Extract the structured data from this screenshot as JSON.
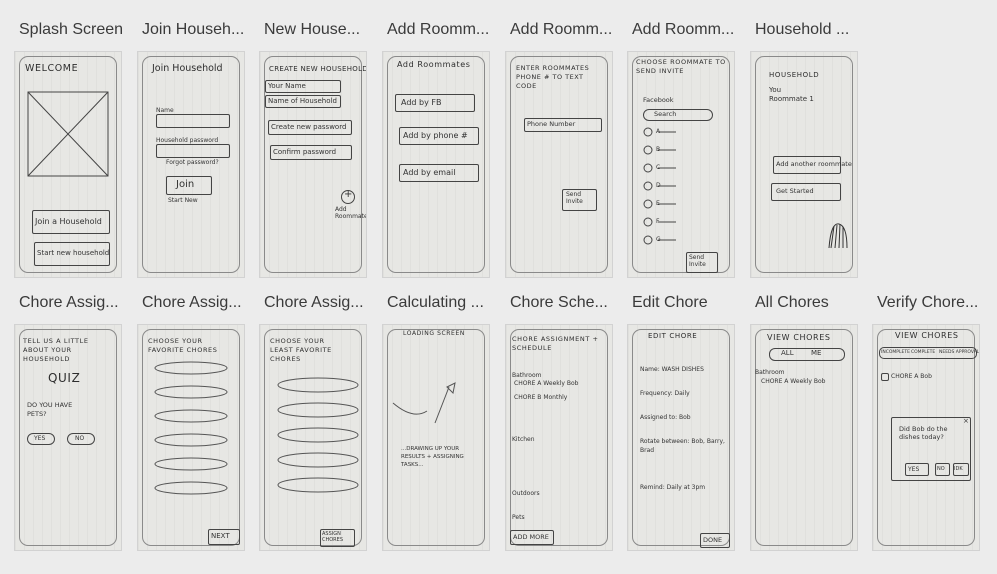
{
  "screens": [
    {
      "title": "Splash Screen",
      "header": "WELCOME",
      "buttons": [
        "Join a Household",
        "Start new household"
      ]
    },
    {
      "title": "Join Househ...",
      "header": "Join Household",
      "fields": [
        "Name",
        "Household password"
      ],
      "link": "Forgot password?",
      "button": "Join",
      "footer": "Start New"
    },
    {
      "title": "New House...",
      "header": "CREATE NEW HOUSEHOLD",
      "fields": [
        "Your Name",
        "Name of Household",
        "Create new password",
        "Confirm password"
      ],
      "add": "Add Roommate"
    },
    {
      "title": "Add Roomm...",
      "header": "Add Roommates",
      "buttons": [
        "Add by FB",
        "Add by phone #",
        "Add by email"
      ]
    },
    {
      "title": "Add Roomm...",
      "header": "ENTER ROOMMATES PHONE # TO TEXT CODE",
      "field": "Phone Number",
      "button": "Send Invite"
    },
    {
      "title": "Add Roomm...",
      "header": "CHOOSE ROOMMATE TO SEND INVITE",
      "source": "Facebook",
      "search": "Search",
      "names": [
        "A",
        "B",
        "C",
        "D",
        "E",
        "F",
        "G"
      ],
      "button": "Send Invite"
    },
    {
      "title": "Household ...",
      "header": "HOUSEHOLD",
      "text": "You Roommate 1",
      "buttons": [
        "Add another roommate",
        "Get Started"
      ]
    },
    {
      "title": "Chore Assig...",
      "header": "TELL US A LITTLE ABOUT YOUR HOUSEHOLD",
      "quiz": "QUIZ",
      "question": "DO YOU HAVE PETS?",
      "answers": [
        "YES",
        "NO"
      ]
    },
    {
      "title": "Chore Assig...",
      "header": "CHOOSE YOUR FAVORITE CHORES",
      "button": "NEXT"
    },
    {
      "title": "Chore Assig...",
      "header": "CHOOSE YOUR LEAST FAVORITE CHORES",
      "button": "ASSIGN CHORES"
    },
    {
      "title": "Calculating ...",
      "header": "LOADING SCREEN",
      "text": "...DRAWING UP YOUR RESULTS + ASSIGNING TASKS..."
    },
    {
      "title": "Chore Sche...",
      "header": "CHORE ASSIGNMENT + SCHEDULE",
      "sections": [
        "Bathroom",
        "Kitchen",
        "Outdoors",
        "Pets"
      ],
      "rows": [
        "CHORE A Weekly Bob",
        "CHORE B Monthly"
      ],
      "button": "ADD MORE"
    },
    {
      "title": "Edit Chore",
      "header": "EDIT CHORE",
      "fields": [
        "Name: WASH DISHES",
        "Frequency: Daily",
        "Assigned to: Bob",
        "Rotate between: Bob, Barry, Brad",
        "Remind: Daily at 3pm"
      ],
      "button": "DONE"
    },
    {
      "title": "All Chores",
      "header": "VIEW CHORES",
      "tabs": [
        "ALL",
        "ME"
      ],
      "section": "Bathroom",
      "row": "CHORE A Weekly Bob"
    },
    {
      "title": "Verify Chore...",
      "header": "VIEW CHORES",
      "tabs": [
        "INCOMPLETE",
        "COMPLETE",
        "NEEDS APPROVAL"
      ],
      "row": "CHORE A Bob",
      "dialog": "Did Bob do the dishes today?",
      "answers": [
        "YES",
        "NO",
        "IDK"
      ]
    }
  ]
}
